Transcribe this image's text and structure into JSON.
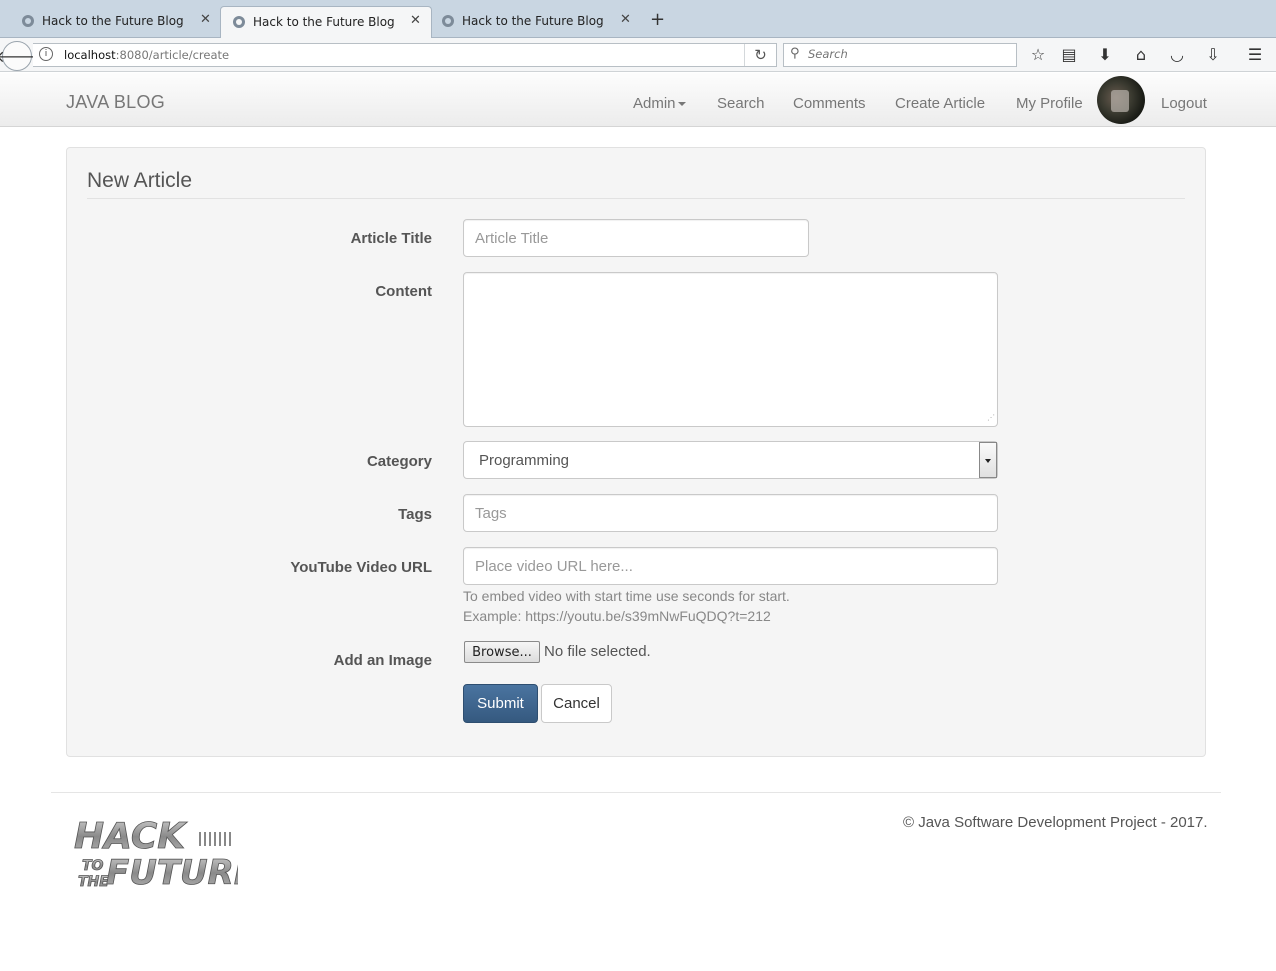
{
  "browser": {
    "tabs": [
      {
        "title": "Hack to the Future Blog",
        "active": false
      },
      {
        "title": "Hack to the Future Blog",
        "active": true
      },
      {
        "title": "Hack to the Future Blog",
        "active": false
      }
    ],
    "new_tab_glyph": "+",
    "url_host": "localhost",
    "url_rest": ":8080/article/create",
    "search_placeholder": "Search",
    "toolbar_icons": [
      "bookmark-star-icon",
      "reading-list-icon",
      "download-icon",
      "home-icon",
      "pocket-icon",
      "download-arrow-icon",
      "menu-icon"
    ]
  },
  "site": {
    "brand": "JAVA BLOG",
    "nav": {
      "admin": "Admin",
      "search": "Search",
      "comments": "Comments",
      "create_article": "Create Article",
      "my_profile": "My Profile",
      "logout": "Logout"
    }
  },
  "form": {
    "legend": "New Article",
    "title_label": "Article Title",
    "title_placeholder": "Article Title",
    "title_value": "",
    "content_label": "Content",
    "content_value": "",
    "category_label": "Category",
    "category_selected": "Programming",
    "tags_label": "Tags",
    "tags_placeholder": "Tags",
    "video_label": "YouTube Video URL",
    "video_placeholder": "Place video URL here...",
    "video_help_1": "To embed video with start time use seconds for start.",
    "video_help_2": "Example: https://youtu.be/s39mNwFuQDQ?t=212",
    "image_label": "Add an Image",
    "browse_label": "Browse...",
    "no_file": "No file selected.",
    "submit": "Submit",
    "cancel": "Cancel"
  },
  "footer": {
    "copyright": "© Java Software Development Project - 2017.",
    "logo_text_top": "HACK",
    "logo_text_to": "TO",
    "logo_text_the": "THE",
    "logo_text_bottom": "FUTURE"
  },
  "colors": {
    "primary_button": "#3f668f",
    "panel_background": "#f5f5f5",
    "header_text": "#777777"
  }
}
